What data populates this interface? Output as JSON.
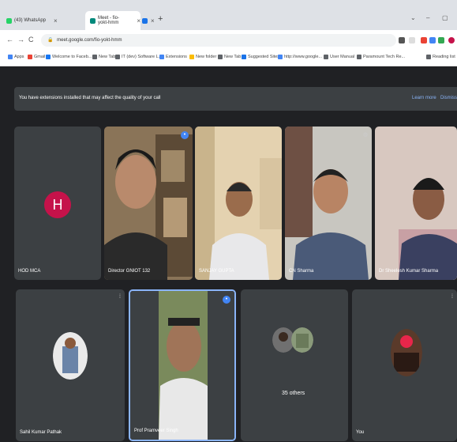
{
  "browser": {
    "tabs": [
      {
        "title": "(43) WhatsApp",
        "favicon_color": "#25d366"
      },
      {
        "title": "Meet - fio-yokt-hmm",
        "favicon_color": "#00897b"
      },
      {
        "title": "",
        "favicon_color": "#1a73e8"
      }
    ],
    "new_tab_symbol": "+",
    "window_controls": {
      "minimize": "–",
      "maximize": "▢",
      "collapse": "⌄"
    },
    "url": "meet.google.com/fio-yokt-hmm",
    "nav": {
      "back": "←",
      "forward": "→",
      "reload": "C"
    },
    "bookmarks": [
      {
        "label": "Apps",
        "color": "#4285f4"
      },
      {
        "label": "Gmail",
        "color": "#ea4335"
      },
      {
        "label": "Welcome to Faceb...",
        "color": "#1877f2"
      },
      {
        "label": "New Tab",
        "color": "#5f6368"
      },
      {
        "label": "IT (dev) Software L...",
        "color": "#5f6368"
      },
      {
        "label": "Extensions",
        "color": "#4285f4"
      },
      {
        "label": "New folder",
        "color": "#fbbc04"
      },
      {
        "label": "New Tab",
        "color": "#5f6368"
      },
      {
        "label": "Suggested Sites",
        "color": "#1a73e8"
      },
      {
        "label": "http://www.google...",
        "color": "#4285f4"
      },
      {
        "label": "User Manual",
        "color": "#5f6368"
      },
      {
        "label": "Paramount Tech Re...",
        "color": "#5f6368"
      },
      {
        "label": "Reading list",
        "color": "#5f6368"
      }
    ]
  },
  "banner": {
    "message": "You have extensions installed that may affect the quality of your call",
    "learn_more": "Learn more",
    "dismiss": "Dismiss"
  },
  "tiles_row1": [
    {
      "name": "HOD MCA",
      "initial": "H"
    },
    {
      "name": "Director GNIOT 132"
    },
    {
      "name": "SANJAY GUPTA"
    },
    {
      "name": "CN Sharma"
    },
    {
      "name": "Dr Sheelesh Kumar Sharma"
    }
  ],
  "tiles_row2": [
    {
      "name": "Sahil Kumar Pathak"
    },
    {
      "name": "Prof Pramveer Singh"
    },
    {
      "name": "",
      "others": "35 others"
    },
    {
      "name": "You"
    }
  ],
  "colors": {
    "meet_bg": "#202124",
    "tile_bg": "#3c4043",
    "accent": "#8ab4f8",
    "avatar_h": "#c5124a"
  }
}
